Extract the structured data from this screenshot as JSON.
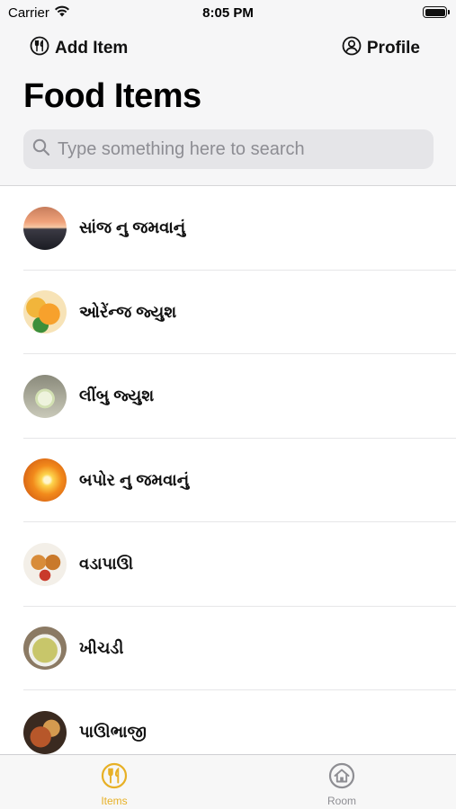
{
  "status": {
    "carrier": "Carrier",
    "time": "8:05 PM"
  },
  "nav": {
    "add_label": "Add Item",
    "add_icon": "fork-knife-circle-icon",
    "profile_label": "Profile",
    "profile_icon": "person-circle-icon"
  },
  "page_title": "Food Items",
  "search": {
    "placeholder": "Type something here to search",
    "value": ""
  },
  "items": [
    {
      "label": "સાંજ નુ જમવાનું",
      "thumb": "sunset"
    },
    {
      "label": "ઓરેંન્જ જ્યુશ",
      "thumb": "orange"
    },
    {
      "label": "લીંબુ જ્યુશ",
      "thumb": "lemon"
    },
    {
      "label": "બપોર નુ જમવાનું",
      "thumb": "sun"
    },
    {
      "label": "વડાપાઊ",
      "thumb": "vada"
    },
    {
      "label": "ખીચડી",
      "thumb": "khichdi"
    },
    {
      "label": "પાઊભાજી",
      "thumb": "pav"
    }
  ],
  "tabs": [
    {
      "label": "Items",
      "icon": "fork-knife-circle-icon",
      "selected": true
    },
    {
      "label": "Room",
      "icon": "house-circle-icon",
      "selected": false
    }
  ],
  "colors": {
    "accent": "#e7b026",
    "inactive": "#8e8e93"
  }
}
